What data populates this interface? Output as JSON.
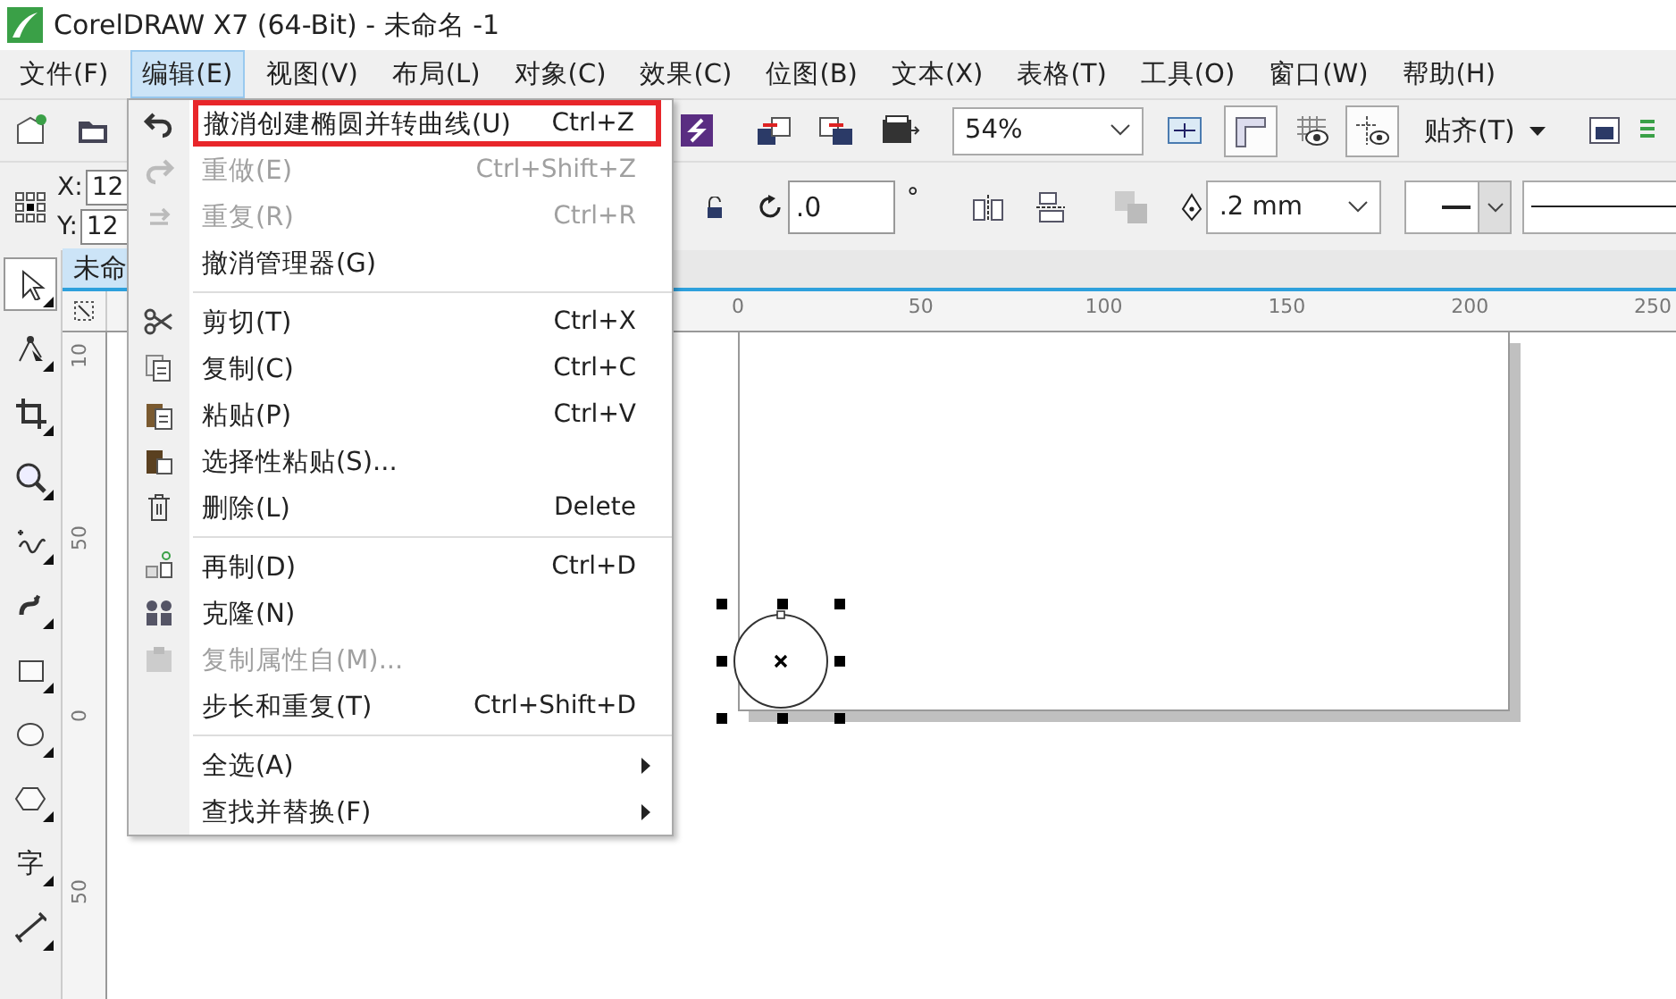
{
  "window": {
    "title": "CorelDRAW X7 (64-Bit) - 未命名 -1"
  },
  "menubar": [
    {
      "label": "文件(F)",
      "selected": false
    },
    {
      "label": "编辑(E)",
      "selected": true
    },
    {
      "label": "视图(V)",
      "selected": false
    },
    {
      "label": "布局(L)",
      "selected": false
    },
    {
      "label": "对象(C)",
      "selected": false
    },
    {
      "label": "效果(C)",
      "selected": false
    },
    {
      "label": "位图(B)",
      "selected": false
    },
    {
      "label": "文本(X)",
      "selected": false
    },
    {
      "label": "表格(T)",
      "selected": false
    },
    {
      "label": "工具(O)",
      "selected": false
    },
    {
      "label": "窗口(W)",
      "selected": false
    },
    {
      "label": "帮助(H)",
      "selected": false
    }
  ],
  "toolbar": {
    "zoom": "54%",
    "toggles": [
      {
        "kind": "rulers",
        "on": true
      },
      {
        "kind": "grid",
        "on": false
      },
      {
        "kind": "guides",
        "on": true
      }
    ],
    "snap": "贴齐(T)"
  },
  "property_bar": {
    "x_label": "X:",
    "x_value": "12",
    "y_label": "Y:",
    "y_value": "12",
    "rotation": ".0",
    "degree": "°",
    "outline_width": ".2 mm"
  },
  "document_tab": {
    "label": "未命",
    "selected": true
  },
  "tools": [
    {
      "kind": "pick",
      "selected": true
    },
    {
      "kind": "shape",
      "selected": false
    },
    {
      "kind": "crop",
      "selected": false
    },
    {
      "kind": "zoom",
      "selected": false
    },
    {
      "kind": "freehand",
      "selected": false
    },
    {
      "kind": "artistic",
      "selected": false
    },
    {
      "kind": "rectangle",
      "selected": false
    },
    {
      "kind": "ellipse",
      "selected": false
    },
    {
      "kind": "polygon",
      "selected": false
    },
    {
      "kind": "text",
      "label": "字",
      "selected": false
    },
    {
      "kind": "dimension",
      "selected": false
    }
  ],
  "rulers": {
    "horizontal": [
      "0",
      "50",
      "100",
      "150",
      "200",
      "250"
    ],
    "vertical": [
      "10",
      "50",
      "0",
      "50"
    ]
  },
  "edit_menu": [
    {
      "kind": "item",
      "label": "撤消创建椭圆并转曲线(U)",
      "shortcut": "Ctrl+Z",
      "disabled": false,
      "highlighted": true,
      "submenu": false
    },
    {
      "kind": "item",
      "label": "重做(E)",
      "shortcut": "Ctrl+Shift+Z",
      "disabled": true,
      "highlighted": false,
      "submenu": false
    },
    {
      "kind": "item",
      "label": "重复(R)",
      "shortcut": "Ctrl+R",
      "disabled": true,
      "highlighted": false,
      "submenu": false
    },
    {
      "kind": "item",
      "label": "撤消管理器(G)",
      "disabled": false,
      "highlighted": false,
      "submenu": false
    },
    {
      "kind": "separator"
    },
    {
      "kind": "item",
      "label": "剪切(T)",
      "shortcut": "Ctrl+X",
      "disabled": false,
      "highlighted": false,
      "submenu": false
    },
    {
      "kind": "item",
      "label": "复制(C)",
      "shortcut": "Ctrl+C",
      "disabled": false,
      "highlighted": false,
      "submenu": false
    },
    {
      "kind": "item",
      "label": "粘贴(P)",
      "shortcut": "Ctrl+V",
      "disabled": false,
      "highlighted": false,
      "submenu": false
    },
    {
      "kind": "item",
      "label": "选择性粘贴(S)...",
      "disabled": false,
      "highlighted": false,
      "submenu": false
    },
    {
      "kind": "item",
      "label": "删除(L)",
      "shortcut": "Delete",
      "disabled": false,
      "highlighted": false,
      "submenu": false
    },
    {
      "kind": "separator"
    },
    {
      "kind": "item",
      "label": "再制(D)",
      "shortcut": "Ctrl+D",
      "disabled": false,
      "highlighted": false,
      "submenu": false
    },
    {
      "kind": "item",
      "label": "克隆(N)",
      "disabled": false,
      "highlighted": false,
      "submenu": false
    },
    {
      "kind": "item",
      "label": "复制属性自(M)...",
      "disabled": true,
      "highlighted": false,
      "submenu": false
    },
    {
      "kind": "item",
      "label": "步长和重复(T)",
      "shortcut": "Ctrl+Shift+D",
      "disabled": false,
      "highlighted": false,
      "submenu": false
    },
    {
      "kind": "separator"
    },
    {
      "kind": "item",
      "label": "全选(A)",
      "disabled": false,
      "highlighted": false,
      "submenu": true
    },
    {
      "kind": "item",
      "label": "查找并替换(F)",
      "disabled": false,
      "highlighted": false,
      "submenu": true
    }
  ]
}
